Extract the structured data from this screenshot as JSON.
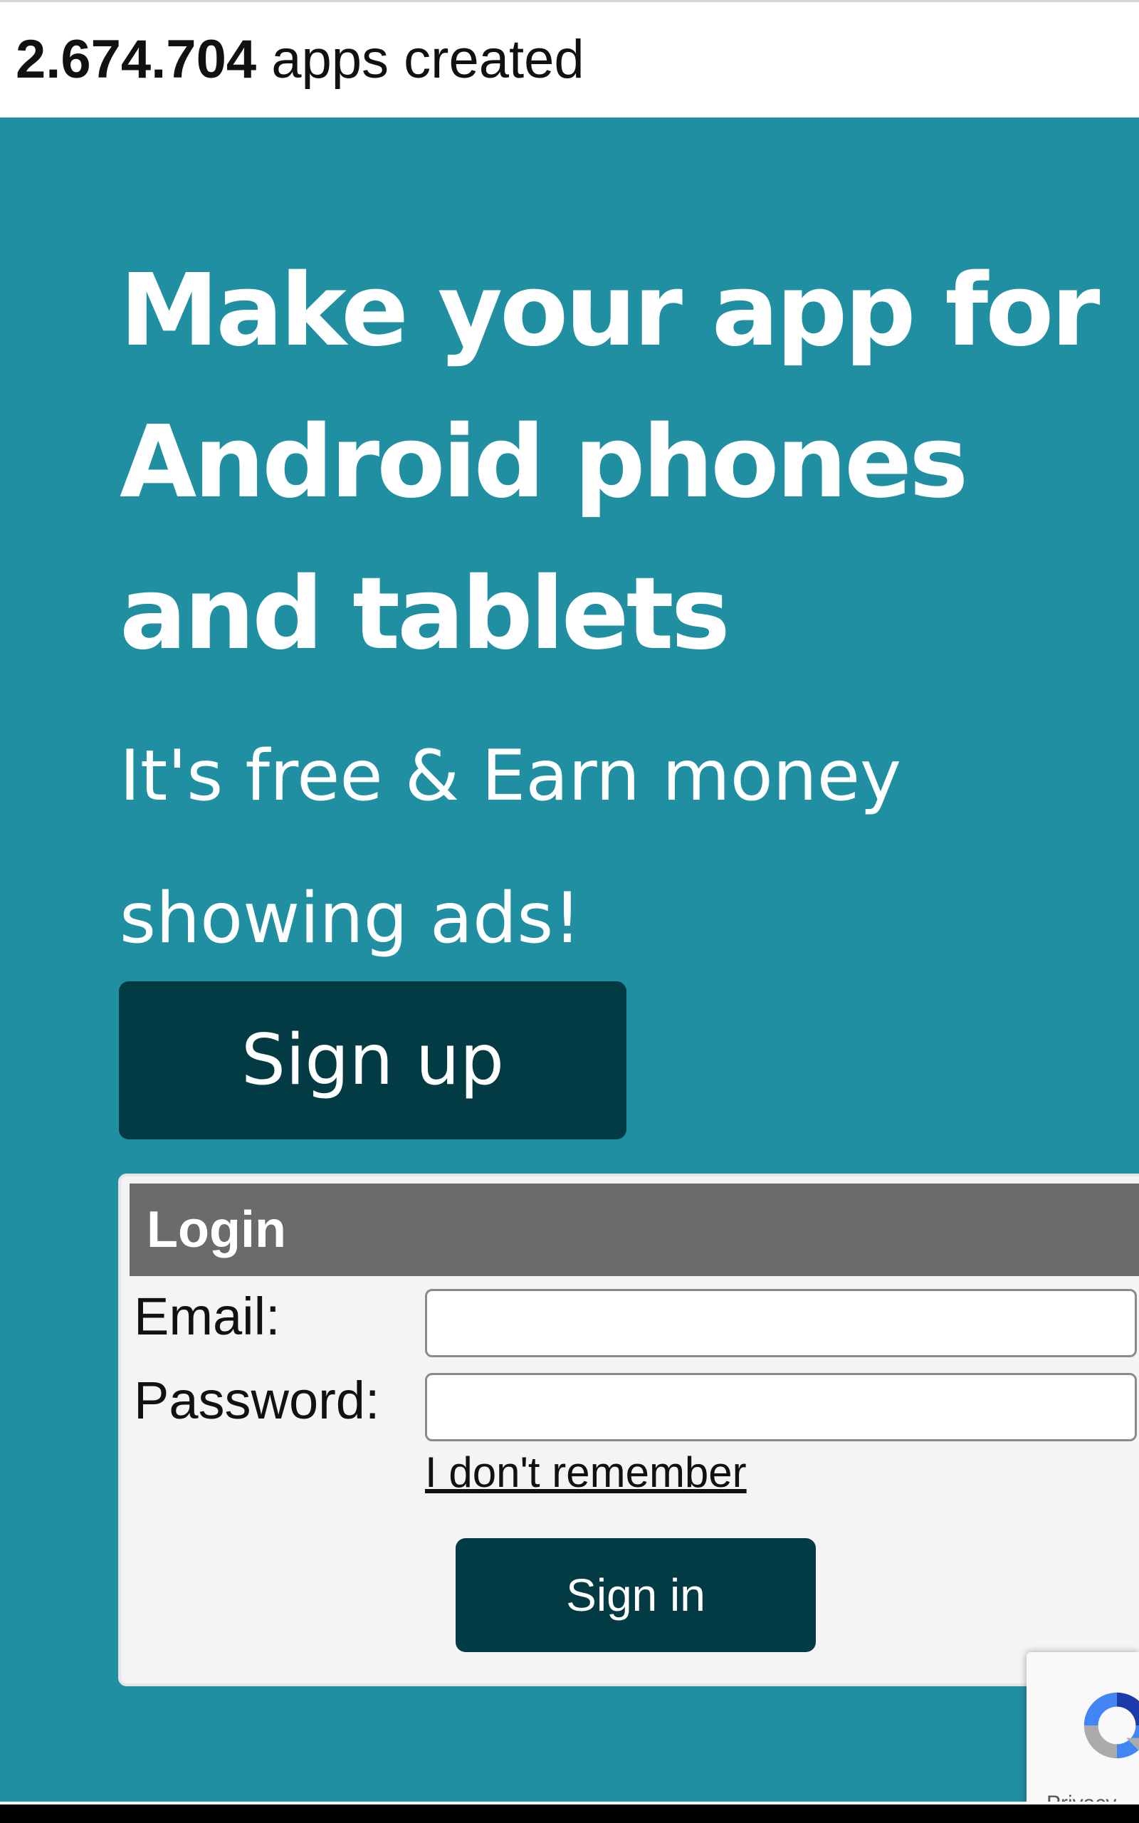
{
  "topbar": {
    "count": "2.674.704",
    "count_suffix": " apps created"
  },
  "hero": {
    "title": "Make your app for Android phones and tablets",
    "subtitle": "It's free & Earn money showing ads!",
    "signup_label": "Sign up"
  },
  "login": {
    "header": "Login",
    "email_label": "Email:",
    "email_value": "",
    "password_label": "Password:",
    "password_value": "",
    "forgot_label": "I don't remember",
    "signin_label": "Sign in"
  },
  "recaptcha": {
    "icon": "recaptcha-logo-icon",
    "text": "Privacy"
  },
  "colors": {
    "background": "#1f8fa1",
    "button": "#033b44",
    "login_header": "#6b6b6b"
  }
}
